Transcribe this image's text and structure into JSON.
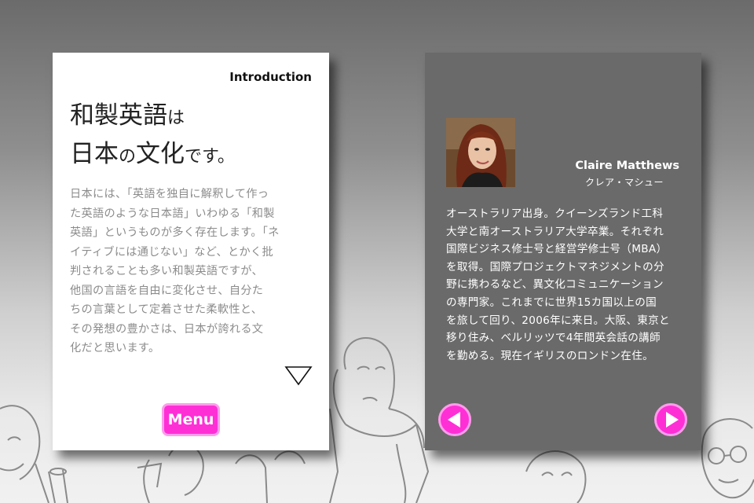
{
  "left_card": {
    "label": "Introduction",
    "headline": {
      "line1_big": "和製英語",
      "line1_small": "は",
      "line2_big_a": "日本",
      "line2_small_a": "の",
      "line2_big_b": "文化",
      "line2_small_b": "です。"
    },
    "body_lines": [
      "日本には、「英語を独自に解釈して作っ",
      "た英語のような日本語」いわゆる「和製",
      "英語」というものが多く存在します。「ネ",
      "イティブには通じない」など、とかく批",
      "判されることも多い和製英語ですが、",
      "他国の言語を自由に変化させ、自分た",
      "ちの言葉として定着させた柔軟性と、",
      "その発想の豊かさは、日本が誇れる文",
      "化だと思います。"
    ],
    "next_icon": "triangle-down-icon",
    "menu_label": "Menu"
  },
  "right_card": {
    "name": "Claire Matthews",
    "name_kana": "クレア・マシュー",
    "bio_lines": [
      "オーストラリア出身。クイーンズランド工科",
      "大学と南オーストラリア大学卒業。それぞれ",
      "国際ビジネス修士号と経営学修士号（MBA）",
      "を取得。国際プロジェクトマネジメントの分",
      "野に携わるなど、異文化コミュニケーション",
      "の専門家。これまでに世界15カ国以上の国",
      "を旅して回り、2006年に来日。大阪、東京と",
      "移り住み、ベルリッツで4年間英会話の講師",
      "を勤める。現在イギリスのロンドン在住。"
    ],
    "prev_icon": "arrow-left-icon",
    "next_icon": "arrow-right-icon"
  },
  "colors": {
    "accent": "#ff2fd6",
    "accent_border": "#ff9cec",
    "dark_card": "#6a6a6a",
    "body_gray": "#8c8c8c"
  }
}
